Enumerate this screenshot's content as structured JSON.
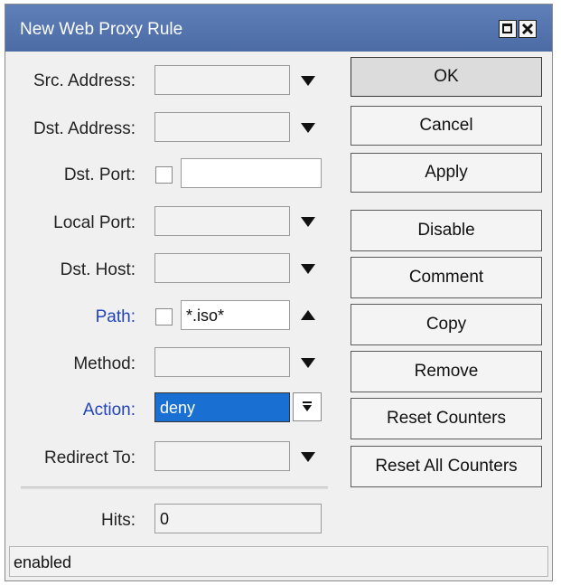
{
  "window": {
    "title": "New Web Proxy Rule"
  },
  "form": {
    "src_address": {
      "label": "Src. Address:",
      "value": ""
    },
    "dst_address": {
      "label": "Dst. Address:",
      "value": ""
    },
    "dst_port": {
      "label": "Dst. Port:",
      "value": ""
    },
    "local_port": {
      "label": "Local Port:",
      "value": ""
    },
    "dst_host": {
      "label": "Dst. Host:",
      "value": ""
    },
    "path": {
      "label": "Path:",
      "value": "*.iso*"
    },
    "method": {
      "label": "Method:",
      "value": ""
    },
    "action": {
      "label": "Action:",
      "value": "deny"
    },
    "redirect_to": {
      "label": "Redirect To:",
      "value": ""
    },
    "hits": {
      "label": "Hits:",
      "value": "0"
    }
  },
  "buttons": {
    "ok": "OK",
    "cancel": "Cancel",
    "apply": "Apply",
    "disable": "Disable",
    "comment": "Comment",
    "copy": "Copy",
    "remove": "Remove",
    "reset_counters": "Reset Counters",
    "reset_all_counters": "Reset All Counters"
  },
  "status": {
    "text": "enabled"
  },
  "colors": {
    "titlebar": "#5a7bb5",
    "highlight_label": "#2244bb",
    "selection": "#1a6fd2"
  }
}
